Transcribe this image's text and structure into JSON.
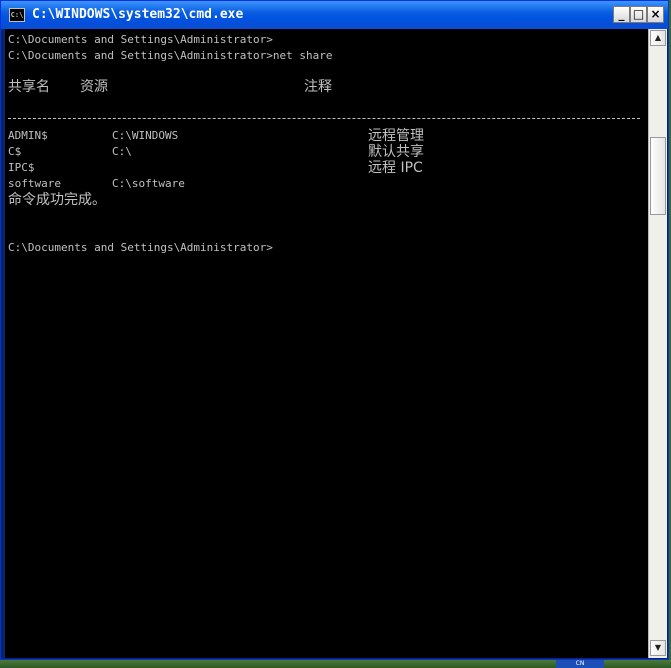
{
  "window": {
    "title": "C:\\WINDOWS\\system32\\cmd.exe",
    "icon_text": "C:\\",
    "buttons": {
      "minimize": "_",
      "maximize": "□",
      "close": "×"
    }
  },
  "console": {
    "lines_top": [
      "C:\\Documents and Settings\\Administrator>",
      "C:\\Documents and Settings\\Administrator>net share"
    ],
    "table": {
      "headers": {
        "name": "共享名",
        "resource": "资源",
        "remark": "注释"
      },
      "rows": [
        {
          "name": "ADMIN$",
          "resource": "C:\\WINDOWS",
          "remark": "远程管理"
        },
        {
          "name": "C$",
          "resource": "C:\\",
          "remark": "默认共享"
        },
        {
          "name": "IPC$",
          "resource": "",
          "remark": "远程 IPC"
        },
        {
          "name": "software",
          "resource": "C:\\software",
          "remark": ""
        }
      ]
    },
    "status": "命令成功完成。",
    "prompt": "C:\\Documents and Settings\\Administrator>"
  },
  "scrollbar": {
    "up_icon": "arrow-up-icon",
    "down_icon": "arrow-down-icon"
  },
  "taskbar": {
    "lang_text": "CN"
  },
  "colors": {
    "titlebar": "#0054e3",
    "console_bg": "#000000",
    "console_text": "#c0c0c0"
  }
}
